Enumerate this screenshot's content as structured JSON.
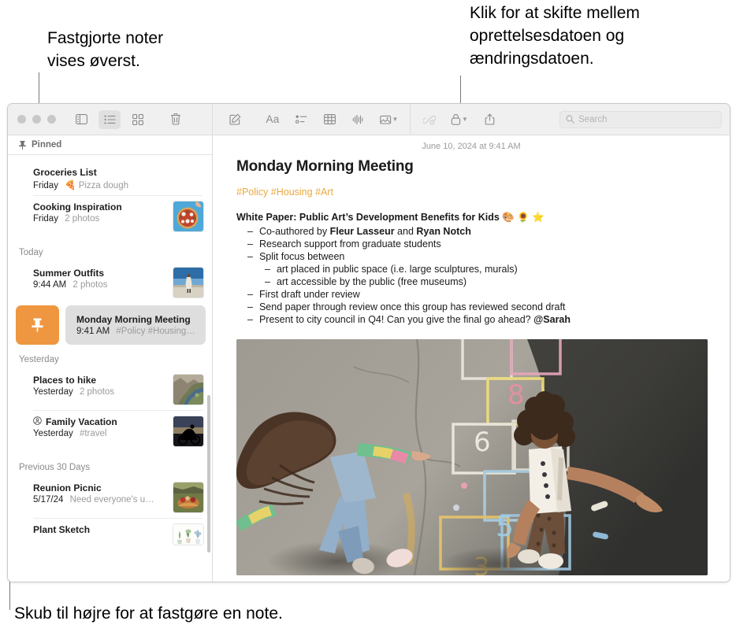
{
  "callouts": {
    "pinned": "Fastgjorte noter\nvises øverst.",
    "date": "Klik for at skifte mellem\noprettelsesdatoen og\nændringsdatoen.",
    "swipe": "Skub til højre for at fastgøre en note."
  },
  "toolbar": {
    "sidebar_toggle": "sidebar-toggle-icon",
    "list_view": "list-view-icon",
    "gallery_view": "gallery-view-icon",
    "delete": "trash-icon",
    "compose": "compose-icon",
    "format": "Aa",
    "checklist": "checklist-icon",
    "table": "table-icon",
    "audio": "audio-waveform-icon",
    "media": "media-icon",
    "media_chevron": "chevron-down-icon",
    "collaborate": "collaborate-icon",
    "lock": "lock-icon",
    "lock_chevron": "chevron-down-icon",
    "share": "share-icon",
    "search_placeholder": "Search",
    "search_value": ""
  },
  "notelist": {
    "pinned_label": "Pinned",
    "sections": [
      {
        "label": "",
        "notes": [
          {
            "title": "Groceries List",
            "date": "Friday",
            "snippet": "Pizza dough",
            "emoji": "🍕",
            "thumb": "none",
            "shared": false
          },
          {
            "title": "Cooking Inspiration",
            "date": "Friday",
            "snippet": "2 photos",
            "emoji": "",
            "thumb": "pizza",
            "shared": false
          }
        ]
      },
      {
        "label": "Today",
        "notes": [
          {
            "title": "Summer Outfits",
            "date": "9:44 AM",
            "snippet": "2 photos",
            "emoji": "",
            "thumb": "outfit",
            "shared": false
          }
        ]
      },
      {
        "label": "Yesterday",
        "notes": [
          {
            "title": "Places to hike",
            "date": "Yesterday",
            "snippet": "2 photos",
            "emoji": "",
            "thumb": "hike",
            "shared": false
          },
          {
            "title": "Family Vacation",
            "date": "Yesterday",
            "snippet": "#travel",
            "emoji": "",
            "thumb": "cyclist",
            "shared": true
          }
        ]
      },
      {
        "label": "Previous 30 Days",
        "notes": [
          {
            "title": "Reunion Picnic",
            "date": "5/17/24",
            "snippet": "Need everyone's u…",
            "emoji": "",
            "thumb": "picnic",
            "shared": false
          },
          {
            "title": "Plant Sketch",
            "date": "",
            "snippet": "",
            "emoji": "",
            "thumb": "plants",
            "shared": false
          }
        ]
      }
    ],
    "selected": {
      "title": "Monday Morning Meeting",
      "date": "9:41 AM",
      "snippet": "#Policy #Housing…",
      "pin_action_icon": "pin-icon"
    }
  },
  "detail": {
    "date": "June 10, 2024 at 9:41 AM",
    "title": "Monday Morning Meeting",
    "tags": "#Policy #Housing #Art",
    "heading": "White Paper: Public Art’s Development Benefits for Kids 🎨 🌻 ⭐",
    "bullets": [
      {
        "level": 1,
        "parts": [
          {
            "t": "Co-authored by ",
            "b": false
          },
          {
            "t": "Fleur Lasseur",
            "b": true
          },
          {
            "t": " and ",
            "b": false
          },
          {
            "t": "Ryan Notch",
            "b": true
          }
        ]
      },
      {
        "level": 1,
        "parts": [
          {
            "t": "Research support from graduate students",
            "b": false
          }
        ]
      },
      {
        "level": 1,
        "parts": [
          {
            "t": "Split focus between",
            "b": false
          }
        ]
      },
      {
        "level": 2,
        "parts": [
          {
            "t": "art placed in public space (i.e. large sculptures, murals)",
            "b": false
          }
        ]
      },
      {
        "level": 2,
        "parts": [
          {
            "t": "art accessible by the public (free museums)",
            "b": false
          }
        ]
      },
      {
        "level": 1,
        "parts": [
          {
            "t": "First draft under review",
            "b": false
          }
        ]
      },
      {
        "level": 1,
        "parts": [
          {
            "t": "Send paper through review once this group has reviewed second draft",
            "b": false
          }
        ]
      },
      {
        "level": 1,
        "parts": [
          {
            "t": "Present to city council in Q4! Can you give the final go ahead? ",
            "b": false
          },
          {
            "t": "@Sarah",
            "b": true
          }
        ]
      }
    ],
    "photo_alt": "Two children playing hopscotch on chalk-drawn asphalt"
  },
  "colors": {
    "accent_orange": "#ee9740",
    "tag_gold": "#e9a83f",
    "selected_row": "#dedede",
    "toolbar_bg": "#f0f0f0"
  }
}
